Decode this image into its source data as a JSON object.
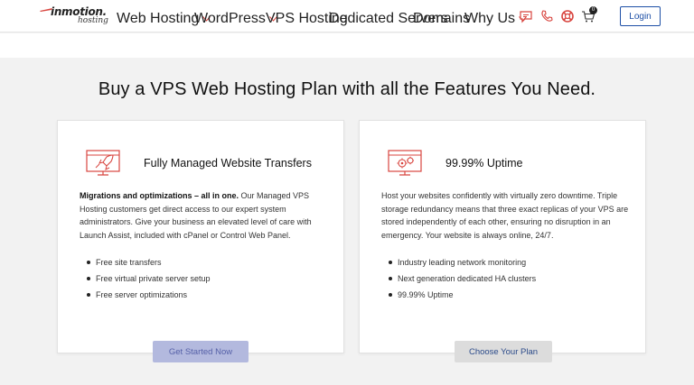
{
  "brand": {
    "logo_top": "inmotion.",
    "logo_bottom": "hosting",
    "accent_color": "#d8453f",
    "link_color": "#1d4fa6"
  },
  "nav": {
    "items": [
      {
        "label": "Web Hosting",
        "dropdown": true
      },
      {
        "label": "WordPress",
        "dropdown": true
      },
      {
        "label": "VPS Hosting",
        "dropdown": false
      },
      {
        "label": "Dedicated Servers",
        "dropdown": false
      },
      {
        "label": "Domains",
        "dropdown": false
      },
      {
        "label": "Why Us",
        "dropdown": true
      }
    ],
    "icons": [
      "chat-icon",
      "phone-icon",
      "support-lifebuoy-icon",
      "cart-icon"
    ],
    "cart_count": "0",
    "login_label": "Login"
  },
  "main": {
    "heading": "Buy a VPS Web Hosting Plan with all the Features You Need.",
    "cards": [
      {
        "icon": "rocket-monitor-icon",
        "title": "Fully Managed Website Transfers",
        "desc_bold": "Migrations and optimizations – all in one.",
        "desc_rest": " Our Managed VPS Hosting customers get direct access to our expert system administrators. Give your business an elevated level of care with Launch Assist, included with cPanel or Control Web Panel.",
        "features": [
          "Free site transfers",
          "Free virtual private server setup",
          "Free server optimizations"
        ],
        "cta": "Get Started Now"
      },
      {
        "icon": "gears-monitor-icon",
        "title": "99.99% Uptime",
        "desc_bold": "",
        "desc_rest": "Host your websites confidently with virtually zero downtime. Triple storage redundancy means that three exact replicas of your VPS are stored independently of each other, ensuring no disruption in an emergency. Your website is always online, 24/7.",
        "features": [
          "Industry leading network monitoring",
          "Next generation dedicated HA clusters",
          "99.99% Uptime"
        ],
        "cta": "Choose Your Plan"
      }
    ]
  }
}
